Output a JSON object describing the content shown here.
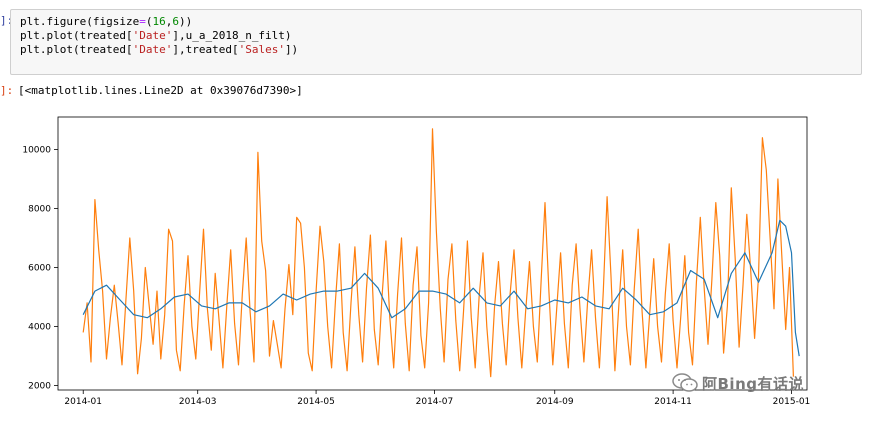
{
  "cell_in": {
    "prompt": "]:",
    "code": {
      "line1": {
        "a": "plt.figure(figsize",
        "op": "=",
        "b": "(",
        "n1": "16",
        "c": ",",
        "n2": "6",
        "d": "))"
      },
      "line2": {
        "a": "plt.plot(treated[",
        "s1": "'Date'",
        "b": "],u_a_2018_n_filt)"
      },
      "line3": {
        "a": "plt.plot(treated[",
        "s1": "'Date'",
        "b": "],treated[",
        "s2": "'Sales'",
        "c": "])"
      }
    }
  },
  "cell_out": {
    "prompt": "]:",
    "text": "[<matplotlib.lines.Line2D at 0x39076d7390>]"
  },
  "watermark": {
    "text": "阿Bing有话说",
    "icon": "wechat-icon"
  },
  "chart_data": {
    "type": "line",
    "title": "",
    "xlabel": "",
    "ylabel": "",
    "xlim": [
      "2013-12-19",
      "2015-01-09"
    ],
    "ylim": [
      1850,
      11100
    ],
    "x_ticks": [
      "2014-01",
      "2014-03",
      "2014-05",
      "2014-07",
      "2014-09",
      "2014-11",
      "2015-01"
    ],
    "y_ticks": [
      2000,
      4000,
      6000,
      8000,
      10000
    ],
    "grid": false,
    "legend": "none",
    "series": [
      {
        "color": "#ff7f0e",
        "points": [
          [
            "2014-01-01",
            3800
          ],
          [
            "2014-01-03",
            4800
          ],
          [
            "2014-01-05",
            2800
          ],
          [
            "2014-01-07",
            8300
          ],
          [
            "2014-01-09",
            6600
          ],
          [
            "2014-01-11",
            5200
          ],
          [
            "2014-01-13",
            2900
          ],
          [
            "2014-01-15",
            4300
          ],
          [
            "2014-01-17",
            5400
          ],
          [
            "2014-01-19",
            4100
          ],
          [
            "2014-01-21",
            2700
          ],
          [
            "2014-01-23",
            4900
          ],
          [
            "2014-01-25",
            7000
          ],
          [
            "2014-01-27",
            5200
          ],
          [
            "2014-01-29",
            2400
          ],
          [
            "2014-01-31",
            3600
          ],
          [
            "2014-02-02",
            6000
          ],
          [
            "2014-02-04",
            4700
          ],
          [
            "2014-02-06",
            3400
          ],
          [
            "2014-02-08",
            5200
          ],
          [
            "2014-02-10",
            2900
          ],
          [
            "2014-02-12",
            4400
          ],
          [
            "2014-02-14",
            7300
          ],
          [
            "2014-02-16",
            6900
          ],
          [
            "2014-02-18",
            3200
          ],
          [
            "2014-02-20",
            2500
          ],
          [
            "2014-02-22",
            4700
          ],
          [
            "2014-02-24",
            6400
          ],
          [
            "2014-02-26",
            4000
          ],
          [
            "2014-02-28",
            2900
          ],
          [
            "2014-03-02",
            5200
          ],
          [
            "2014-03-04",
            7300
          ],
          [
            "2014-03-06",
            4600
          ],
          [
            "2014-03-08",
            3200
          ],
          [
            "2014-03-10",
            5800
          ],
          [
            "2014-03-12",
            4200
          ],
          [
            "2014-03-14",
            2600
          ],
          [
            "2014-03-16",
            4700
          ],
          [
            "2014-03-18",
            6600
          ],
          [
            "2014-03-20",
            4100
          ],
          [
            "2014-03-22",
            2700
          ],
          [
            "2014-03-24",
            5100
          ],
          [
            "2014-03-26",
            7000
          ],
          [
            "2014-03-28",
            4500
          ],
          [
            "2014-03-30",
            2800
          ],
          [
            "2014-04-01",
            9900
          ],
          [
            "2014-04-03",
            6900
          ],
          [
            "2014-04-05",
            5900
          ],
          [
            "2014-04-07",
            3000
          ],
          [
            "2014-04-09",
            4200
          ],
          [
            "2014-04-11",
            3400
          ],
          [
            "2014-04-13",
            2600
          ],
          [
            "2014-04-15",
            4600
          ],
          [
            "2014-04-17",
            6100
          ],
          [
            "2014-04-19",
            4400
          ],
          [
            "2014-04-21",
            7700
          ],
          [
            "2014-04-23",
            7500
          ],
          [
            "2014-04-25",
            6000
          ],
          [
            "2014-04-27",
            3100
          ],
          [
            "2014-04-29",
            2500
          ],
          [
            "2014-05-01",
            5200
          ],
          [
            "2014-05-03",
            7400
          ],
          [
            "2014-05-05",
            6200
          ],
          [
            "2014-05-07",
            4000
          ],
          [
            "2014-05-09",
            2600
          ],
          [
            "2014-05-11",
            4900
          ],
          [
            "2014-05-13",
            6800
          ],
          [
            "2014-05-15",
            3800
          ],
          [
            "2014-05-17",
            2500
          ],
          [
            "2014-05-19",
            4800
          ],
          [
            "2014-05-21",
            6700
          ],
          [
            "2014-05-23",
            4400
          ],
          [
            "2014-05-25",
            2800
          ],
          [
            "2014-05-27",
            5300
          ],
          [
            "2014-05-29",
            7100
          ],
          [
            "2014-05-31",
            3900
          ],
          [
            "2014-06-02",
            2700
          ],
          [
            "2014-06-04",
            5000
          ],
          [
            "2014-06-06",
            6900
          ],
          [
            "2014-06-08",
            4300
          ],
          [
            "2014-06-10",
            2600
          ],
          [
            "2014-06-12",
            5100
          ],
          [
            "2014-06-14",
            7000
          ],
          [
            "2014-06-16",
            4100
          ],
          [
            "2014-06-18",
            2500
          ],
          [
            "2014-06-20",
            5400
          ],
          [
            "2014-06-22",
            6700
          ],
          [
            "2014-06-24",
            3700
          ],
          [
            "2014-06-26",
            2600
          ],
          [
            "2014-06-28",
            4800
          ],
          [
            "2014-06-30",
            10700
          ],
          [
            "2014-07-02",
            7200
          ],
          [
            "2014-07-04",
            4600
          ],
          [
            "2014-07-06",
            2800
          ],
          [
            "2014-07-08",
            5600
          ],
          [
            "2014-07-10",
            6800
          ],
          [
            "2014-07-12",
            4200
          ],
          [
            "2014-07-14",
            2500
          ],
          [
            "2014-07-16",
            4500
          ],
          [
            "2014-07-18",
            6900
          ],
          [
            "2014-07-20",
            4300
          ],
          [
            "2014-07-22",
            2600
          ],
          [
            "2014-07-24",
            5000
          ],
          [
            "2014-07-26",
            6500
          ],
          [
            "2014-07-28",
            4000
          ],
          [
            "2014-07-30",
            2300
          ],
          [
            "2014-08-01",
            4700
          ],
          [
            "2014-08-03",
            6200
          ],
          [
            "2014-08-05",
            4100
          ],
          [
            "2014-08-07",
            2700
          ],
          [
            "2014-08-09",
            5100
          ],
          [
            "2014-08-11",
            6600
          ],
          [
            "2014-08-13",
            4300
          ],
          [
            "2014-08-15",
            2600
          ],
          [
            "2014-08-17",
            4500
          ],
          [
            "2014-08-19",
            6200
          ],
          [
            "2014-08-21",
            4000
          ],
          [
            "2014-08-23",
            2800
          ],
          [
            "2014-08-25",
            5600
          ],
          [
            "2014-08-27",
            8200
          ],
          [
            "2014-08-29",
            5200
          ],
          [
            "2014-08-31",
            2700
          ],
          [
            "2014-09-02",
            4600
          ],
          [
            "2014-09-04",
            6500
          ],
          [
            "2014-09-06",
            4100
          ],
          [
            "2014-09-08",
            2600
          ],
          [
            "2014-09-10",
            5400
          ],
          [
            "2014-09-12",
            6800
          ],
          [
            "2014-09-14",
            4600
          ],
          [
            "2014-09-16",
            2800
          ],
          [
            "2014-09-18",
            4900
          ],
          [
            "2014-09-20",
            6600
          ],
          [
            "2014-09-22",
            4300
          ],
          [
            "2014-09-24",
            2600
          ],
          [
            "2014-09-26",
            5200
          ],
          [
            "2014-09-28",
            8400
          ],
          [
            "2014-09-30",
            5700
          ],
          [
            "2014-10-02",
            2500
          ],
          [
            "2014-10-04",
            4700
          ],
          [
            "2014-10-06",
            6600
          ],
          [
            "2014-10-08",
            4000
          ],
          [
            "2014-10-10",
            2700
          ],
          [
            "2014-10-12",
            5300
          ],
          [
            "2014-10-14",
            7300
          ],
          [
            "2014-10-16",
            4500
          ],
          [
            "2014-10-18",
            2600
          ],
          [
            "2014-10-20",
            4500
          ],
          [
            "2014-10-22",
            6300
          ],
          [
            "2014-10-24",
            4000
          ],
          [
            "2014-10-26",
            2800
          ],
          [
            "2014-10-28",
            5100
          ],
          [
            "2014-10-30",
            6800
          ],
          [
            "2014-11-01",
            4200
          ],
          [
            "2014-11-03",
            2600
          ],
          [
            "2014-11-05",
            4400
          ],
          [
            "2014-11-07",
            6400
          ],
          [
            "2014-11-09",
            3800
          ],
          [
            "2014-11-11",
            2700
          ],
          [
            "2014-11-13",
            5500
          ],
          [
            "2014-11-15",
            7700
          ],
          [
            "2014-11-17",
            5300
          ],
          [
            "2014-11-19",
            3400
          ],
          [
            "2014-11-21",
            5600
          ],
          [
            "2014-11-23",
            8200
          ],
          [
            "2014-11-25",
            6400
          ],
          [
            "2014-11-27",
            3100
          ],
          [
            "2014-11-29",
            4700
          ],
          [
            "2014-12-01",
            8700
          ],
          [
            "2014-12-03",
            6300
          ],
          [
            "2014-12-05",
            3300
          ],
          [
            "2014-12-07",
            5400
          ],
          [
            "2014-12-09",
            7800
          ],
          [
            "2014-12-11",
            5900
          ],
          [
            "2014-12-13",
            3600
          ],
          [
            "2014-12-15",
            5700
          ],
          [
            "2014-12-17",
            10400
          ],
          [
            "2014-12-19",
            9300
          ],
          [
            "2014-12-21",
            7000
          ],
          [
            "2014-12-23",
            4600
          ],
          [
            "2014-12-25",
            9000
          ],
          [
            "2014-12-27",
            6400
          ],
          [
            "2014-12-29",
            3900
          ],
          [
            "2014-12-31",
            6000
          ],
          [
            "2015-01-02",
            2300
          ]
        ]
      },
      {
        "color": "#1f77b4",
        "points": [
          [
            "2014-01-01",
            4400
          ],
          [
            "2014-01-07",
            5200
          ],
          [
            "2014-01-13",
            5400
          ],
          [
            "2014-01-20",
            4900
          ],
          [
            "2014-01-27",
            4400
          ],
          [
            "2014-02-03",
            4300
          ],
          [
            "2014-02-10",
            4600
          ],
          [
            "2014-02-17",
            5000
          ],
          [
            "2014-02-24",
            5100
          ],
          [
            "2014-03-03",
            4700
          ],
          [
            "2014-03-10",
            4600
          ],
          [
            "2014-03-17",
            4800
          ],
          [
            "2014-03-24",
            4800
          ],
          [
            "2014-03-31",
            4500
          ],
          [
            "2014-04-07",
            4700
          ],
          [
            "2014-04-14",
            5100
          ],
          [
            "2014-04-21",
            4900
          ],
          [
            "2014-04-28",
            5100
          ],
          [
            "2014-05-05",
            5200
          ],
          [
            "2014-05-12",
            5200
          ],
          [
            "2014-05-19",
            5300
          ],
          [
            "2014-05-26",
            5800
          ],
          [
            "2014-06-02",
            5300
          ],
          [
            "2014-06-09",
            4300
          ],
          [
            "2014-06-16",
            4600
          ],
          [
            "2014-06-23",
            5200
          ],
          [
            "2014-06-30",
            5200
          ],
          [
            "2014-07-07",
            5100
          ],
          [
            "2014-07-14",
            4800
          ],
          [
            "2014-07-21",
            5300
          ],
          [
            "2014-07-28",
            4800
          ],
          [
            "2014-08-04",
            4700
          ],
          [
            "2014-08-11",
            5200
          ],
          [
            "2014-08-18",
            4600
          ],
          [
            "2014-08-25",
            4700
          ],
          [
            "2014-09-01",
            4900
          ],
          [
            "2014-09-08",
            4800
          ],
          [
            "2014-09-15",
            5000
          ],
          [
            "2014-09-22",
            4700
          ],
          [
            "2014-09-29",
            4600
          ],
          [
            "2014-10-06",
            5300
          ],
          [
            "2014-10-13",
            4900
          ],
          [
            "2014-10-20",
            4400
          ],
          [
            "2014-10-27",
            4500
          ],
          [
            "2014-11-03",
            4800
          ],
          [
            "2014-11-10",
            5900
          ],
          [
            "2014-11-17",
            5600
          ],
          [
            "2014-11-24",
            4300
          ],
          [
            "2014-12-01",
            5800
          ],
          [
            "2014-12-08",
            6500
          ],
          [
            "2014-12-15",
            5500
          ],
          [
            "2014-12-22",
            6500
          ],
          [
            "2014-12-26",
            7600
          ],
          [
            "2014-12-29",
            7400
          ],
          [
            "2015-01-01",
            6500
          ],
          [
            "2015-01-03",
            3800
          ],
          [
            "2015-01-05",
            3000
          ]
        ]
      }
    ]
  }
}
